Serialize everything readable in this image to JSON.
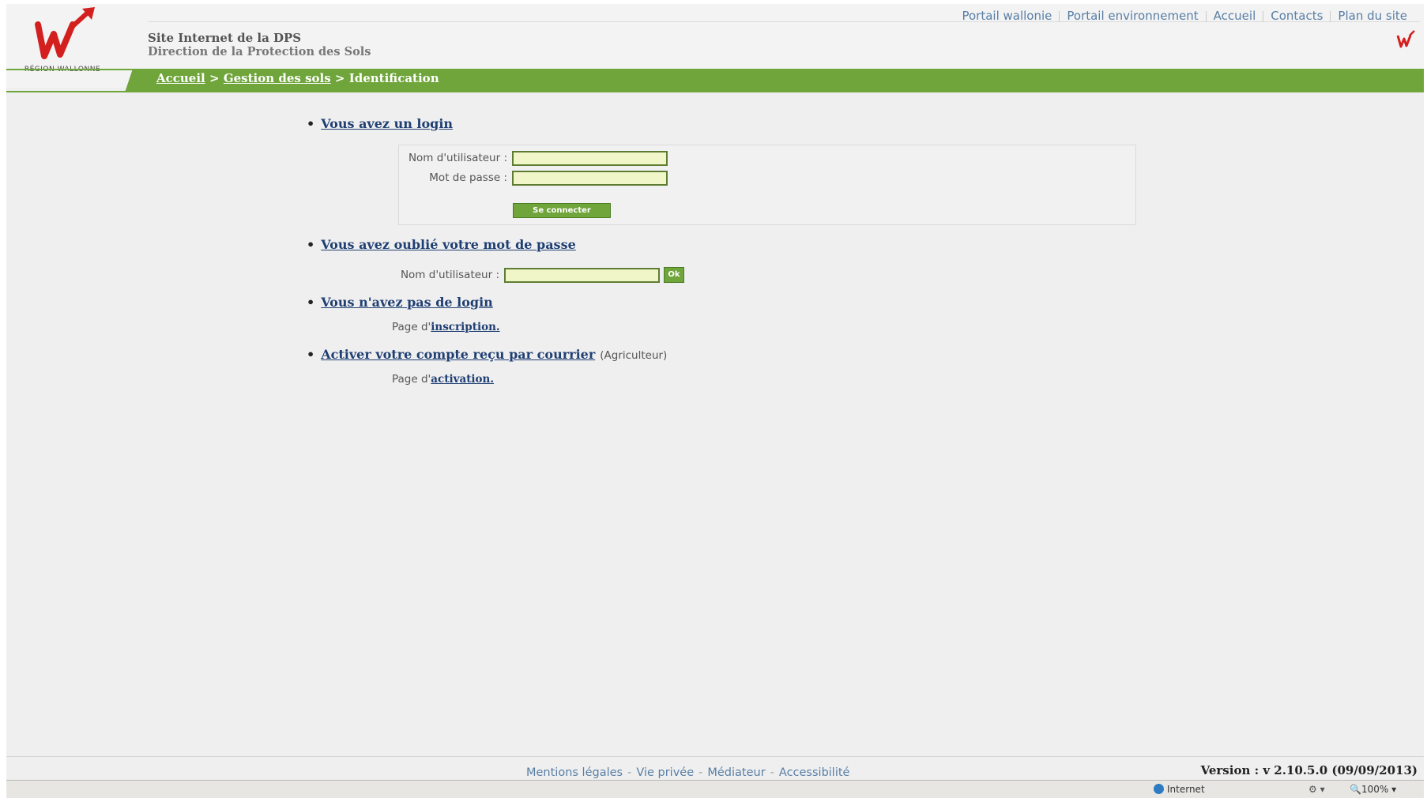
{
  "header": {
    "logo_text": "RÉGION WALLONNE",
    "site_title": "Site Internet de la DPS",
    "site_subtitle": "Direction de la Protection des Sols",
    "top_nav": [
      "Portail wallonie",
      "Portail environnement",
      "Accueil",
      "Contacts",
      "Plan du site"
    ]
  },
  "breadcrumb": {
    "items": [
      "Accueil",
      "Gestion des sols"
    ],
    "separator": ">",
    "current": "Identification"
  },
  "login_section": {
    "title": "Vous avez un login",
    "username_label": "Nom d'utilisateur :",
    "username_value": "",
    "password_label": "Mot de passe :",
    "password_value": "",
    "submit_label": "Se connecter"
  },
  "forgot_section": {
    "title": "Vous avez oublié votre mot de passe",
    "username_label": "Nom d'utilisateur :",
    "username_value": "",
    "ok_label": "Ok"
  },
  "no_login_section": {
    "title": "Vous n'avez pas de login",
    "text_prefix": "Page d'",
    "link": "inscription."
  },
  "activate_section": {
    "title": "Activer votre compte reçu par courrier",
    "note": "(Agriculteur)",
    "text_prefix": "Page d'",
    "link": "activation."
  },
  "footer": {
    "links": [
      "Mentions légales",
      "Vie privée",
      "Médiateur",
      "Accessibilité"
    ],
    "separator": "-",
    "version": "Version : v 2.10.5.0 (09/09/2013)"
  },
  "status_bar": {
    "zone": "Internet",
    "zoom": "100%"
  },
  "colors": {
    "accent_green": "#6fa53a",
    "link_blue": "#1f3f73",
    "logo_red": "#d3201f"
  }
}
